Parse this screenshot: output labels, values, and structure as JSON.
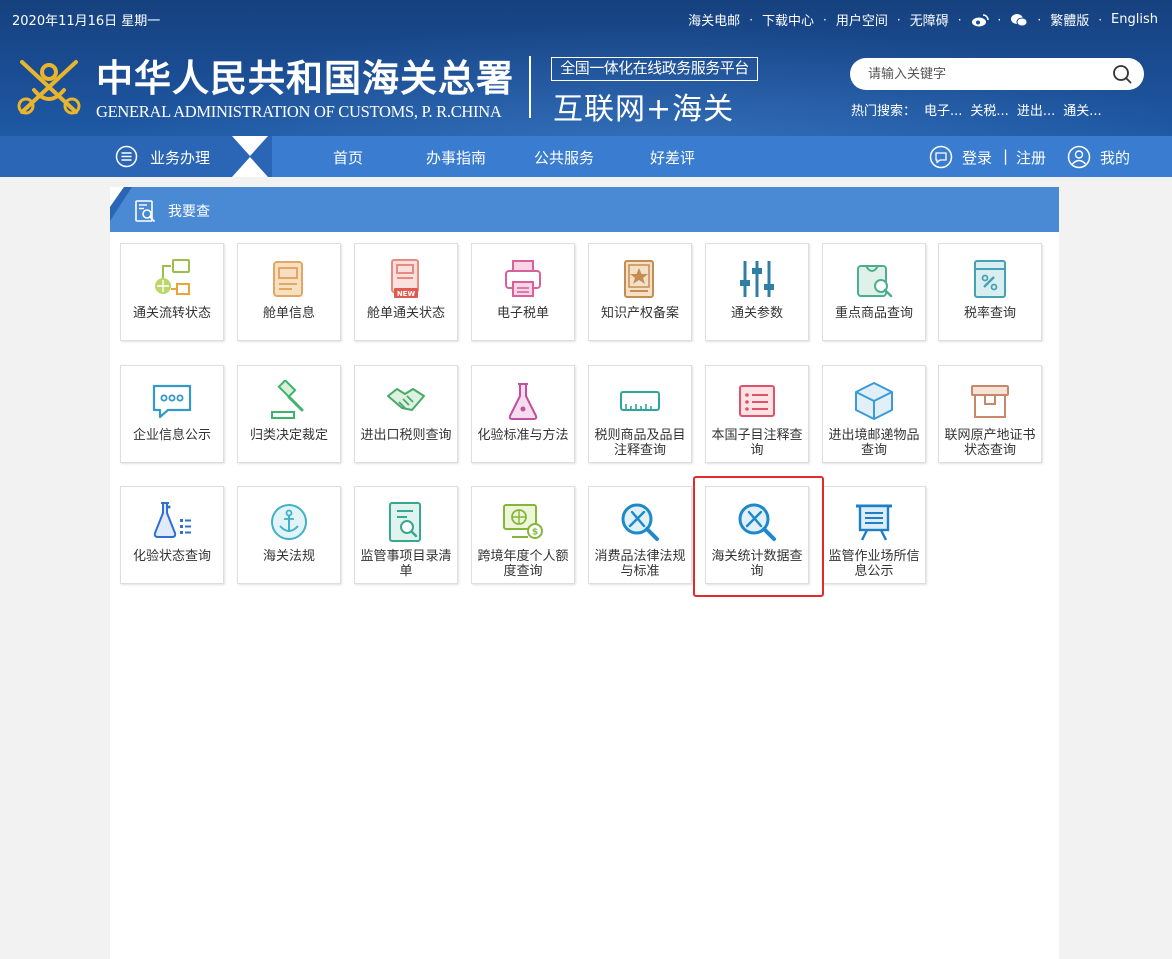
{
  "header": {
    "date": "2020年11月16日  星期一",
    "top_links": [
      "海关电邮",
      "下载中心",
      "用户空间",
      "无障碍",
      "繁體版",
      "English"
    ],
    "separator": "·",
    "title_cn": "中华人民共和国海关总署",
    "title_en": "GENERAL ADMINISTRATION OF CUSTOMS, P. R.CHINA",
    "platform_box": "全国一体化在线政务服务平台",
    "platform_name": "互联网+海关",
    "search_placeholder": "请输入关键字",
    "hot_label": "热门搜索：",
    "hot_terms": [
      "电子...",
      "关税...",
      "进出...",
      "通关..."
    ]
  },
  "nav": {
    "biz_label": "业务办理",
    "items": [
      "首页",
      "办事指南",
      "公共服务",
      "好差评"
    ],
    "login": "登录",
    "divider": "|",
    "register": "注册",
    "mine": "我的"
  },
  "panel": {
    "title": "我要查",
    "tiles": [
      {
        "label": "通关流转状态",
        "icon": "workflow-icon"
      },
      {
        "label": "舱单信息",
        "icon": "manifest-icon"
      },
      {
        "label": "舱单通关状态",
        "icon": "manifest-new-icon"
      },
      {
        "label": "电子税单",
        "icon": "printer-icon"
      },
      {
        "label": "知识产权备案",
        "icon": "star-certificate-icon"
      },
      {
        "label": "通关参数",
        "icon": "sliders-icon"
      },
      {
        "label": "重点商品查询",
        "icon": "bag-search-icon"
      },
      {
        "label": "税率查询",
        "icon": "tax-book-icon"
      },
      {
        "label": "企业信息公示",
        "icon": "chat-dots-icon"
      },
      {
        "label": "归类决定裁定",
        "icon": "gavel-icon"
      },
      {
        "label": "进出口税则查询",
        "icon": "handshake-icon"
      },
      {
        "label": "化验标准与方法",
        "icon": "flask-icon"
      },
      {
        "label": "税则商品及品目注释查询",
        "icon": "ruler-icon"
      },
      {
        "label": "本国子目注释查询",
        "icon": "list-card-icon"
      },
      {
        "label": "进出境邮递物品查询",
        "icon": "box-icon"
      },
      {
        "label": "联网原产地证书状态查询",
        "icon": "archive-box-icon"
      },
      {
        "label": "化验状态查询",
        "icon": "lab-list-icon"
      },
      {
        "label": "海关法规",
        "icon": "anchor-icon"
      },
      {
        "label": "监管事项目录清单",
        "icon": "doc-search-icon"
      },
      {
        "label": "跨境年度个人额度查询",
        "icon": "monitor-globe-icon"
      },
      {
        "label": "消费品法律法规与标准",
        "icon": "magnifier-tools-icon"
      },
      {
        "label": "海关统计数据查询",
        "icon": "magnifier-tools-icon"
      },
      {
        "label": "监管作业场所信息公示",
        "icon": "board-icon"
      }
    ]
  },
  "colors": {
    "header_bg": "#1b4e95",
    "nav_bg": "#3a7dd0",
    "panel_head": "#4a89d4",
    "highlight": "#e02b2b"
  }
}
